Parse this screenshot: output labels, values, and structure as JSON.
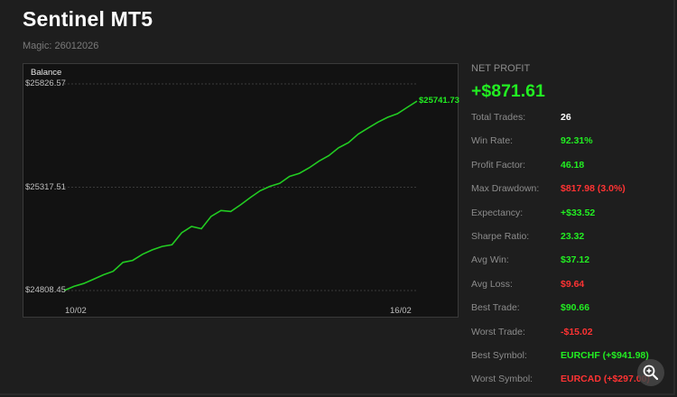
{
  "header": {
    "title": "Sentinel MT5",
    "magic": "Magic: 26012026"
  },
  "chart_data": {
    "type": "line",
    "title": "Balance",
    "ytick_labels": [
      "$25826.57",
      "$25317.51",
      "$24808.45"
    ],
    "yticks": [
      25826.57,
      25317.51,
      24808.45
    ],
    "ylim": [
      24808.45,
      25826.57
    ],
    "xtick_labels": [
      "10/02",
      "16/02"
    ],
    "last_value_label": "$25741.73",
    "line_color": "#22cc22",
    "series": [
      {
        "values": [
          24808.45,
          24829.0,
          24843.0,
          24864.0,
          24886.0,
          24903.0,
          24947.0,
          24957.0,
          24987.0,
          25009.0,
          25026.0,
          25034.0,
          25093.0,
          25124.0,
          25113.0,
          25174.0,
          25203.0,
          25198.0,
          25231.0,
          25267.0,
          25300.0,
          25322.0,
          25337.0,
          25371.0,
          25386.0,
          25413.0,
          25446.0,
          25473.0,
          25512.0,
          25537.0,
          25579.0,
          25609.0,
          25638.0,
          25662.0,
          25680.0,
          25711.0,
          25741.73
        ]
      }
    ]
  },
  "stats": {
    "net_profit_label": "NET PROFIT",
    "net_profit_value": "+$871.61",
    "rows": [
      {
        "label": "Total Trades:",
        "value": "26",
        "color": "#ffffff"
      },
      {
        "label": "Win Rate:",
        "value": "92.31%",
        "color": "#22ee22"
      },
      {
        "label": "Profit Factor:",
        "value": "46.18",
        "color": "#22ee22"
      },
      {
        "label": "Max Drawdown:",
        "value": "$817.98 (3.0%)",
        "color": "#ff3333"
      },
      {
        "label": "Expectancy:",
        "value": "+$33.52",
        "color": "#22ee22"
      },
      {
        "label": "Sharpe Ratio:",
        "value": "23.32",
        "color": "#22ee22"
      },
      {
        "label": "Avg Win:",
        "value": "$37.12",
        "color": "#22ee22"
      },
      {
        "label": "Avg Loss:",
        "value": "$9.64",
        "color": "#ff3333"
      },
      {
        "label": "Best Trade:",
        "value": "$90.66",
        "color": "#22ee22"
      },
      {
        "label": "Worst Trade:",
        "value": "-$15.02",
        "color": "#ff3333"
      },
      {
        "label": "Best Symbol:",
        "value": "EURCHF (+$941.98)",
        "color": "#22ee22"
      },
      {
        "label": "Worst Symbol:",
        "value": "EURCAD (+$297.00)",
        "color": "#ff3333"
      }
    ]
  },
  "icons": {
    "zoom": "zoom-in-icon"
  }
}
